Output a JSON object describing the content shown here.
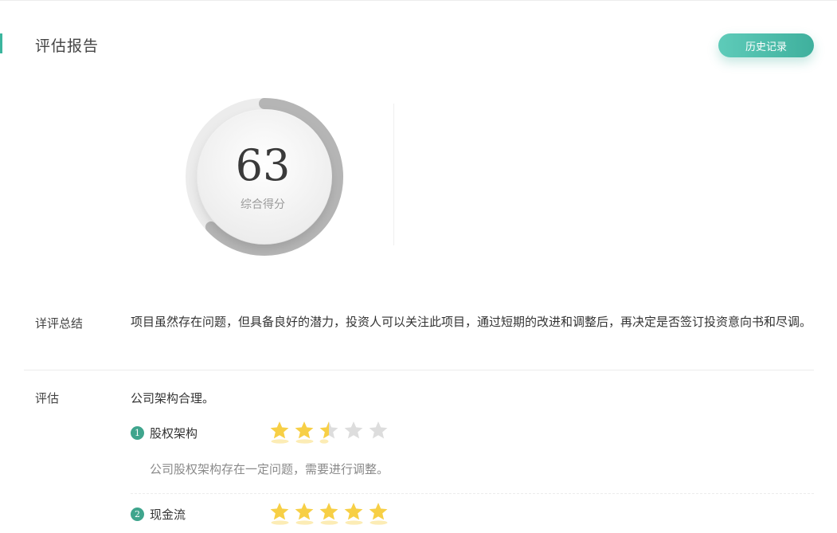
{
  "header": {
    "title": "评估报告",
    "history_button": "历史记录"
  },
  "score": {
    "value": "63",
    "label": "综合得分",
    "percent": 63
  },
  "summary": {
    "label": "详评总结",
    "text": "项目虽然存在问题，但具备良好的潜力，投资人可以关注此项目，通过短期的改进和调整后，再决定是否签订投资意向书和尽调。"
  },
  "evaluation": {
    "label": "评估",
    "overview": "公司架构合理。",
    "items": [
      {
        "index": "1",
        "name": "股权架构",
        "rating": 2.5,
        "max_rating": 5,
        "description": "公司股权架构存在一定问题，需要进行调整。"
      },
      {
        "index": "2",
        "name": "现金流",
        "rating": 5,
        "max_rating": 5
      }
    ]
  },
  "colors": {
    "accent": "#3bb59e",
    "star_filled": "#f7cf45",
    "star_empty": "#dddddd",
    "gauge_arc": "#b5b5b5"
  },
  "icons": {
    "rating": "star-icon"
  }
}
